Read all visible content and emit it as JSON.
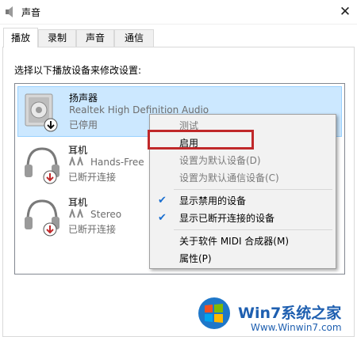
{
  "window": {
    "title": "声音",
    "close_glyph": "✕"
  },
  "tabs": [
    {
      "label": "播放",
      "active": true
    },
    {
      "label": "录制",
      "active": false
    },
    {
      "label": "声音",
      "active": false
    },
    {
      "label": "通信",
      "active": false
    }
  ],
  "instruction": "选择以下播放设备来修改设置:",
  "devices": [
    {
      "name": "扬声器",
      "description": "Realtek High Definition Audio",
      "status": "已停用",
      "icon": "speaker-icon",
      "selected": true
    },
    {
      "name": "耳机",
      "description": "Hands-Free",
      "status": "已断开连接",
      "icon": "headphones-icon",
      "selected": false
    },
    {
      "name": "耳机",
      "description": "Stereo",
      "status": "已断开连接",
      "icon": "headphones-icon",
      "selected": false
    }
  ],
  "context_menu": {
    "items": [
      {
        "label": "测试",
        "enabled": false,
        "checked": false
      },
      {
        "label": "启用",
        "enabled": true,
        "checked": false
      },
      {
        "label": "设置为默认设备(D)",
        "enabled": false,
        "checked": false
      },
      {
        "label": "设置为默认通信设备(C)",
        "enabled": false,
        "checked": false
      },
      {
        "label": "显示禁用的设备",
        "enabled": true,
        "checked": true
      },
      {
        "label": "显示已断开连接的设备",
        "enabled": true,
        "checked": true
      },
      {
        "label": "关于软件 MIDI 合成器(M)",
        "enabled": true,
        "checked": false
      },
      {
        "label": "属性(P)",
        "enabled": true,
        "checked": false
      }
    ],
    "check_glyph": "✔"
  },
  "watermark": {
    "brand_main": "Win7系统之家",
    "url": "Www.Winwin7.com"
  },
  "colors": {
    "selection_bg": "#cce8ff",
    "highlight_border": "#c0282a",
    "check": "#1a6fd0"
  }
}
